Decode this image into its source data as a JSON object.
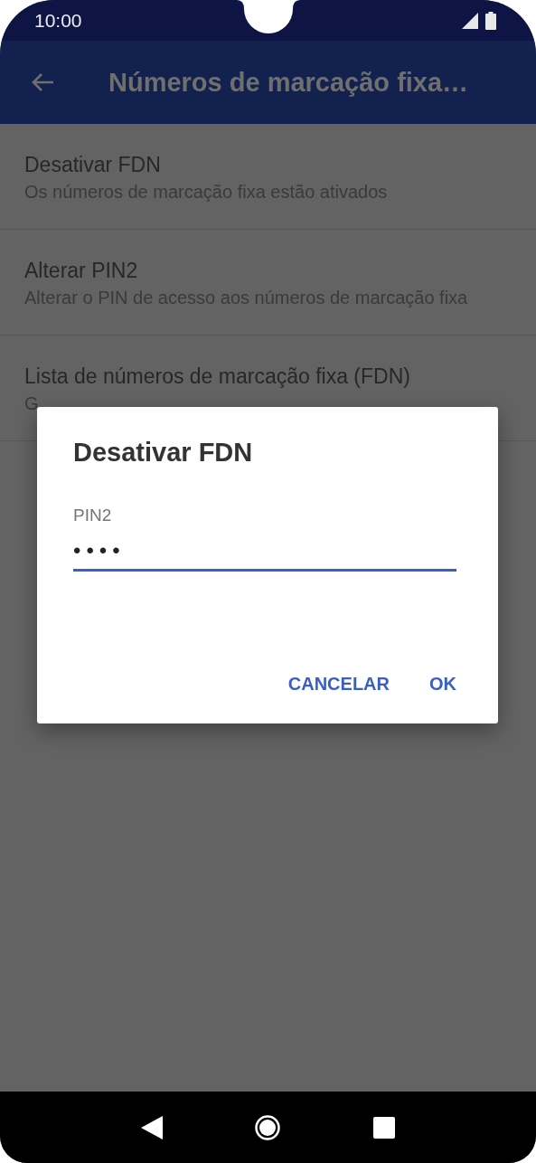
{
  "status_bar": {
    "time": "10:00"
  },
  "app_bar": {
    "title": "Números de marcação fixa…"
  },
  "settings": [
    {
      "title": "Desativar FDN",
      "summary": "Os números de marcação fixa estão ativados"
    },
    {
      "title": "Alterar PIN2",
      "summary": "Alterar o PIN de acesso aos números de marcação fixa"
    },
    {
      "title": "Lista de números de marcação fixa (FDN)",
      "summary": "G"
    }
  ],
  "dialog": {
    "title": "Desativar FDN",
    "field": {
      "label": "PIN2",
      "value": "••••"
    },
    "buttons": [
      "CANCELAR",
      "OK"
    ]
  }
}
